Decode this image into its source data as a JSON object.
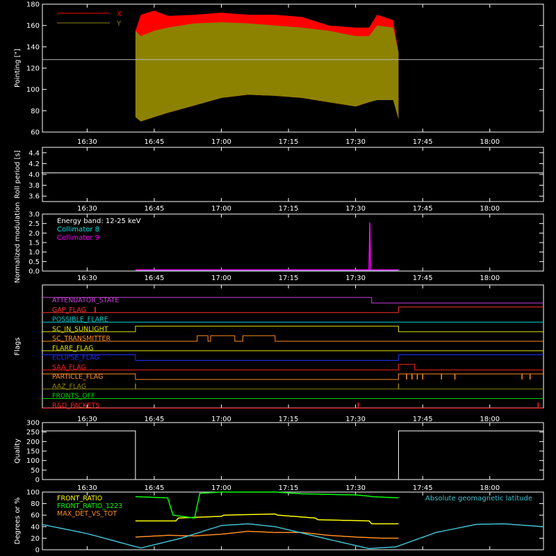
{
  "chart_data": [
    {
      "type": "area",
      "ylabel": "Pointing [\"]",
      "ylim": [
        60,
        180
      ],
      "yticks": [
        60,
        80,
        100,
        120,
        140,
        160,
        180
      ],
      "xticks": [
        "16:30",
        "16:45",
        "17:00",
        "17:15",
        "17:30",
        "17:45",
        "18:00"
      ],
      "reference_line": 128,
      "series": [
        {
          "name": "X",
          "color": "#ff0000",
          "t": [
            16.68,
            16.7,
            16.75,
            16.8,
            16.9,
            17.0,
            17.1,
            17.2,
            17.3,
            17.4,
            17.5,
            17.55,
            17.58,
            17.64,
            17.66
          ],
          "lower": [
            74,
            70,
            74,
            78,
            85,
            92,
            95,
            94,
            92,
            88,
            84,
            88,
            112,
            108,
            72
          ],
          "upper": [
            155,
            170,
            174,
            169,
            170,
            172,
            170,
            170,
            168,
            160,
            158,
            158,
            170,
            165,
            135
          ]
        },
        {
          "name": "Y",
          "color": "#8c8200",
          "t": [
            16.68,
            16.7,
            16.75,
            16.8,
            16.9,
            17.0,
            17.1,
            17.2,
            17.3,
            17.4,
            17.5,
            17.55,
            17.58,
            17.64,
            17.66
          ],
          "lower": [
            74,
            70,
            74,
            78,
            85,
            92,
            95,
            94,
            92,
            88,
            84,
            88,
            90,
            90,
            72
          ],
          "upper": [
            155,
            150,
            155,
            158,
            162,
            163,
            162,
            160,
            158,
            155,
            150,
            150,
            160,
            158,
            135
          ]
        }
      ]
    },
    {
      "type": "line",
      "ylabel": "Roll period [s]",
      "ylim": [
        3.5,
        4.5
      ],
      "yticks": [
        3.6,
        3.8,
        4.0,
        4.2,
        4.4
      ],
      "xticks": [
        "16:30",
        "16:45",
        "17:00",
        "17:15",
        "17:30",
        "17:45",
        "18:00"
      ],
      "series": [
        {
          "color": "#ffffff",
          "x": [
            16.33,
            18.2
          ],
          "y": [
            4.03,
            4.03
          ]
        }
      ]
    },
    {
      "type": "line",
      "ylabel": "Normalized modulation",
      "ylim": [
        0,
        3
      ],
      "yticks": [
        0.0,
        0.5,
        1.0,
        1.5,
        2.0,
        2.5,
        3.0
      ],
      "xticks": [
        "16:30",
        "16:45",
        "17:00",
        "17:15",
        "17:30",
        "17:45",
        "18:00"
      ],
      "legend_title": "Energy band: 12-25 keV",
      "series": [
        {
          "name": "Collimator 8",
          "color": "#00e5e5",
          "x": [
            16.68,
            17.66
          ],
          "y": [
            0.05,
            0.05
          ]
        },
        {
          "name": "Collimator 9",
          "color": "#ff00ff",
          "x": [
            16.68,
            17.55,
            17.553,
            17.556,
            17.66
          ],
          "y": [
            0.06,
            0.06,
            2.55,
            0.06,
            0.06
          ]
        }
      ]
    },
    {
      "type": "line",
      "ylabel": "Flags",
      "xticks": [
        "16:30",
        "16:45",
        "17:00",
        "17:15",
        "17:30",
        "17:45",
        "18:00"
      ],
      "flags": [
        {
          "name": "ATTENUATOR_STATE",
          "color": "#d040e0",
          "segments": [
            [
              16.33,
              17.56,
              1
            ],
            [
              17.56,
              18.2,
              0
            ]
          ]
        },
        {
          "name": "GAP_FLAG",
          "color": "#ff3030",
          "segments": [
            [
              16.33,
              16.68,
              0
            ],
            [
              16.68,
              17.66,
              0
            ],
            [
              17.66,
              18.2,
              1
            ]
          ],
          "spikes": [
            16.53
          ]
        },
        {
          "name": "POSSIBLE_FLARE",
          "color": "#00c8c8",
          "segments": [
            [
              16.33,
              18.2,
              0
            ]
          ]
        },
        {
          "name": "SC_IN_SUNLIGHT",
          "color": "#e0e000",
          "segments": [
            [
              16.33,
              16.68,
              0
            ],
            [
              16.68,
              17.66,
              1
            ],
            [
              17.66,
              18.2,
              0
            ]
          ]
        },
        {
          "name": "SC_TRANSMITTER",
          "color": "#ff8c20",
          "segments": [
            [
              16.33,
              16.91,
              0
            ],
            [
              16.91,
              16.95,
              1
            ],
            [
              16.95,
              16.96,
              0
            ],
            [
              16.96,
              17.05,
              1
            ],
            [
              17.05,
              17.08,
              0
            ],
            [
              17.08,
              17.2,
              1
            ],
            [
              17.2,
              18.2,
              0
            ]
          ]
        },
        {
          "name": "FLARE_FLAG",
          "color": "#e0e000",
          "segments": [
            [
              16.33,
              18.2,
              0
            ]
          ]
        },
        {
          "name": "ECLIPSE_FLAG",
          "color": "#2030ff",
          "segments": [
            [
              16.33,
              16.68,
              1
            ],
            [
              16.68,
              17.66,
              0
            ],
            [
              17.66,
              18.2,
              1
            ]
          ]
        },
        {
          "name": "SAA_FLAG",
          "color": "#ff2020",
          "segments": [
            [
              16.33,
              17.66,
              0
            ],
            [
              17.66,
              17.72,
              1
            ],
            [
              17.72,
              18.2,
              0
            ]
          ]
        },
        {
          "name": "PARTICLE_FLAG",
          "color": "#ff8c20",
          "segments": [
            [
              16.33,
              16.68,
              1
            ],
            [
              16.68,
              17.66,
              0
            ],
            [
              17.66,
              18.2,
              1
            ]
          ],
          "spikes": [
            17.69,
            17.71,
            17.73,
            17.75,
            17.82,
            17.87,
            18.12,
            18.15
          ]
        },
        {
          "name": "AAZ_FLAG",
          "color": "#8c8200",
          "segments": [
            [
              16.33,
              18.2,
              0
            ]
          ],
          "spikes": [
            16.68,
            17.66
          ]
        },
        {
          "name": "FRONTS_OFF",
          "color": "#00d000",
          "segments": [
            [
              16.33,
              18.2,
              0
            ]
          ]
        },
        {
          "name": "R&D_PACKETS",
          "color": "#ff2020",
          "segments": [
            [
              16.33,
              18.2,
              0
            ]
          ],
          "spikes": [
            17.51,
            18.18
          ]
        }
      ]
    },
    {
      "type": "line",
      "ylabel": "Quality",
      "ylim": [
        0,
        300
      ],
      "yticks": [
        0,
        50,
        100,
        150,
        200,
        250,
        300
      ],
      "xticks": [
        "16:30",
        "16:45",
        "17:00",
        "17:15",
        "17:30",
        "17:45",
        "18:00"
      ],
      "series": [
        {
          "color": "#ffffff",
          "x": [
            16.33,
            16.68,
            16.68,
            17.66,
            17.66,
            18.2
          ],
          "y": [
            256,
            256,
            0,
            0,
            256,
            256
          ]
        }
      ]
    },
    {
      "type": "line",
      "ylabel": "Degrees or %",
      "ylim": [
        0,
        100
      ],
      "yticks": [
        0,
        20,
        40,
        60,
        80,
        100
      ],
      "legend_right": "Absolute geomagnetic latitude",
      "series": [
        {
          "name": "FRONT_RATIO",
          "color": "#ffff00",
          "x": [
            16.68,
            16.83,
            16.84,
            17.0,
            17.01,
            17.2,
            17.21,
            17.35,
            17.36,
            17.55,
            17.56,
            17.66
          ],
          "y": [
            50,
            50,
            55,
            58,
            60,
            62,
            60,
            55,
            52,
            50,
            45,
            45
          ]
        },
        {
          "name": "FRONT_RATIO_1223",
          "color": "#00ff00",
          "x": [
            16.68,
            16.8,
            16.82,
            16.9,
            16.92,
            17.0,
            17.2,
            17.3,
            17.5,
            17.55,
            17.56,
            17.66
          ],
          "y": [
            92,
            90,
            60,
            55,
            98,
            100,
            100,
            97,
            95,
            93,
            92,
            90
          ]
        },
        {
          "name": "MAX_DET_VS_TOT",
          "color": "#ff8c20",
          "x": [
            16.68,
            16.8,
            16.9,
            17.0,
            17.1,
            17.2,
            17.3,
            17.4,
            17.5,
            17.6,
            17.66
          ],
          "y": [
            22,
            25,
            24,
            27,
            32,
            30,
            30,
            25,
            22,
            20,
            20
          ]
        },
        {
          "name": "Absolute geomagnetic latitude",
          "color": "#40c0d0",
          "x": [
            16.33,
            16.5,
            16.7,
            16.85,
            17.0,
            17.1,
            17.2,
            17.4,
            17.55,
            17.65,
            17.8,
            17.95,
            18.05,
            18.2
          ],
          "y": [
            44,
            28,
            3,
            20,
            42,
            45,
            40,
            18,
            2,
            5,
            30,
            44,
            45,
            40
          ]
        }
      ]
    }
  ]
}
